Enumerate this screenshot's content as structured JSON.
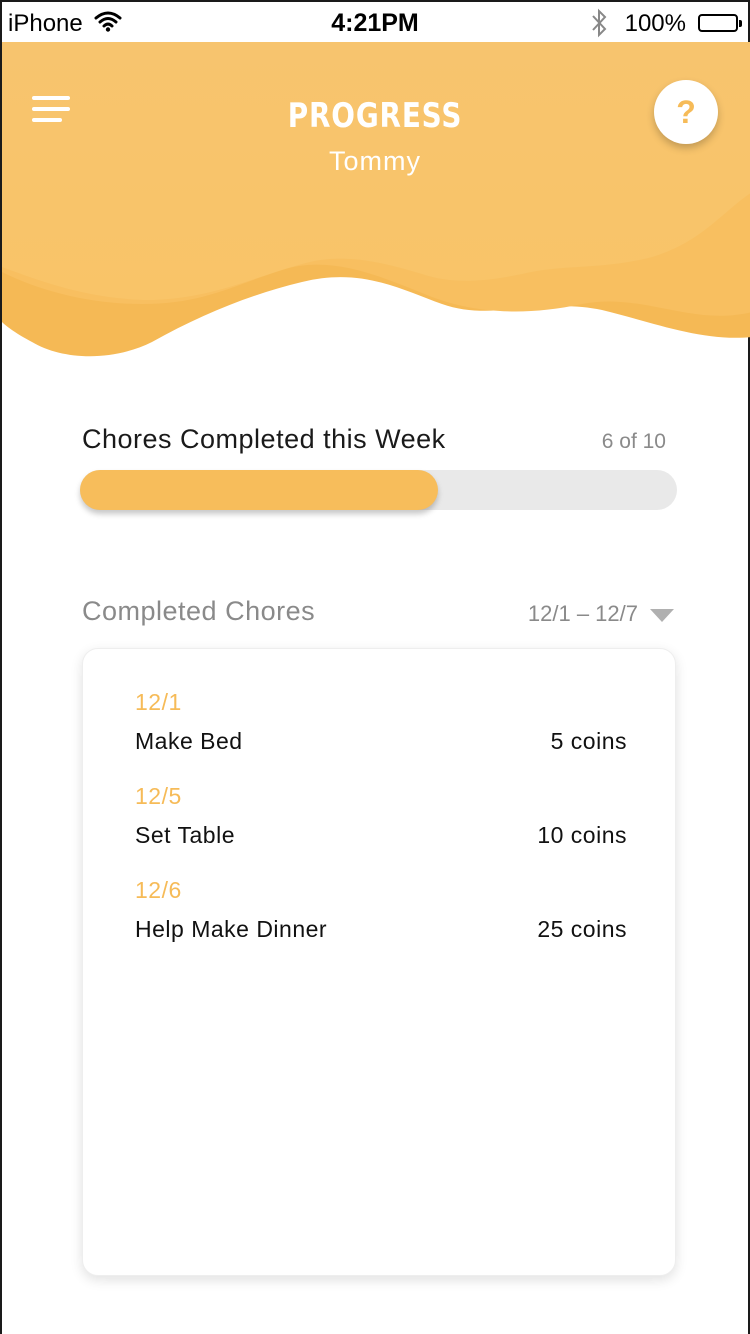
{
  "status_bar": {
    "carrier": "iPhone",
    "time": "4:21PM",
    "battery": "100%"
  },
  "header": {
    "title": "PROGRESS",
    "subtitle": "Tommy",
    "help_label": "?",
    "color": "#f7c167"
  },
  "weekly_progress": {
    "label": "Chores Completed this Week",
    "count_text": "6 of 10",
    "completed": 6,
    "total": 10,
    "fill_color": "#f7bd5b",
    "track_color": "#e9e9e9"
  },
  "completed_chores": {
    "title": "Completed Chores",
    "range": "12/1 – 12/7",
    "entries": [
      {
        "date": "12/1",
        "name": "Make Bed",
        "coins": "5 coins"
      },
      {
        "date": "12/5",
        "name": "Set Table",
        "coins": "10 coins"
      },
      {
        "date": "12/6",
        "name": "Help Make Dinner",
        "coins": "25 coins"
      }
    ]
  },
  "icons": [
    "wifi-icon",
    "bluetooth-icon",
    "battery-icon",
    "menu-icon",
    "help-icon",
    "chevron-down-icon"
  ]
}
